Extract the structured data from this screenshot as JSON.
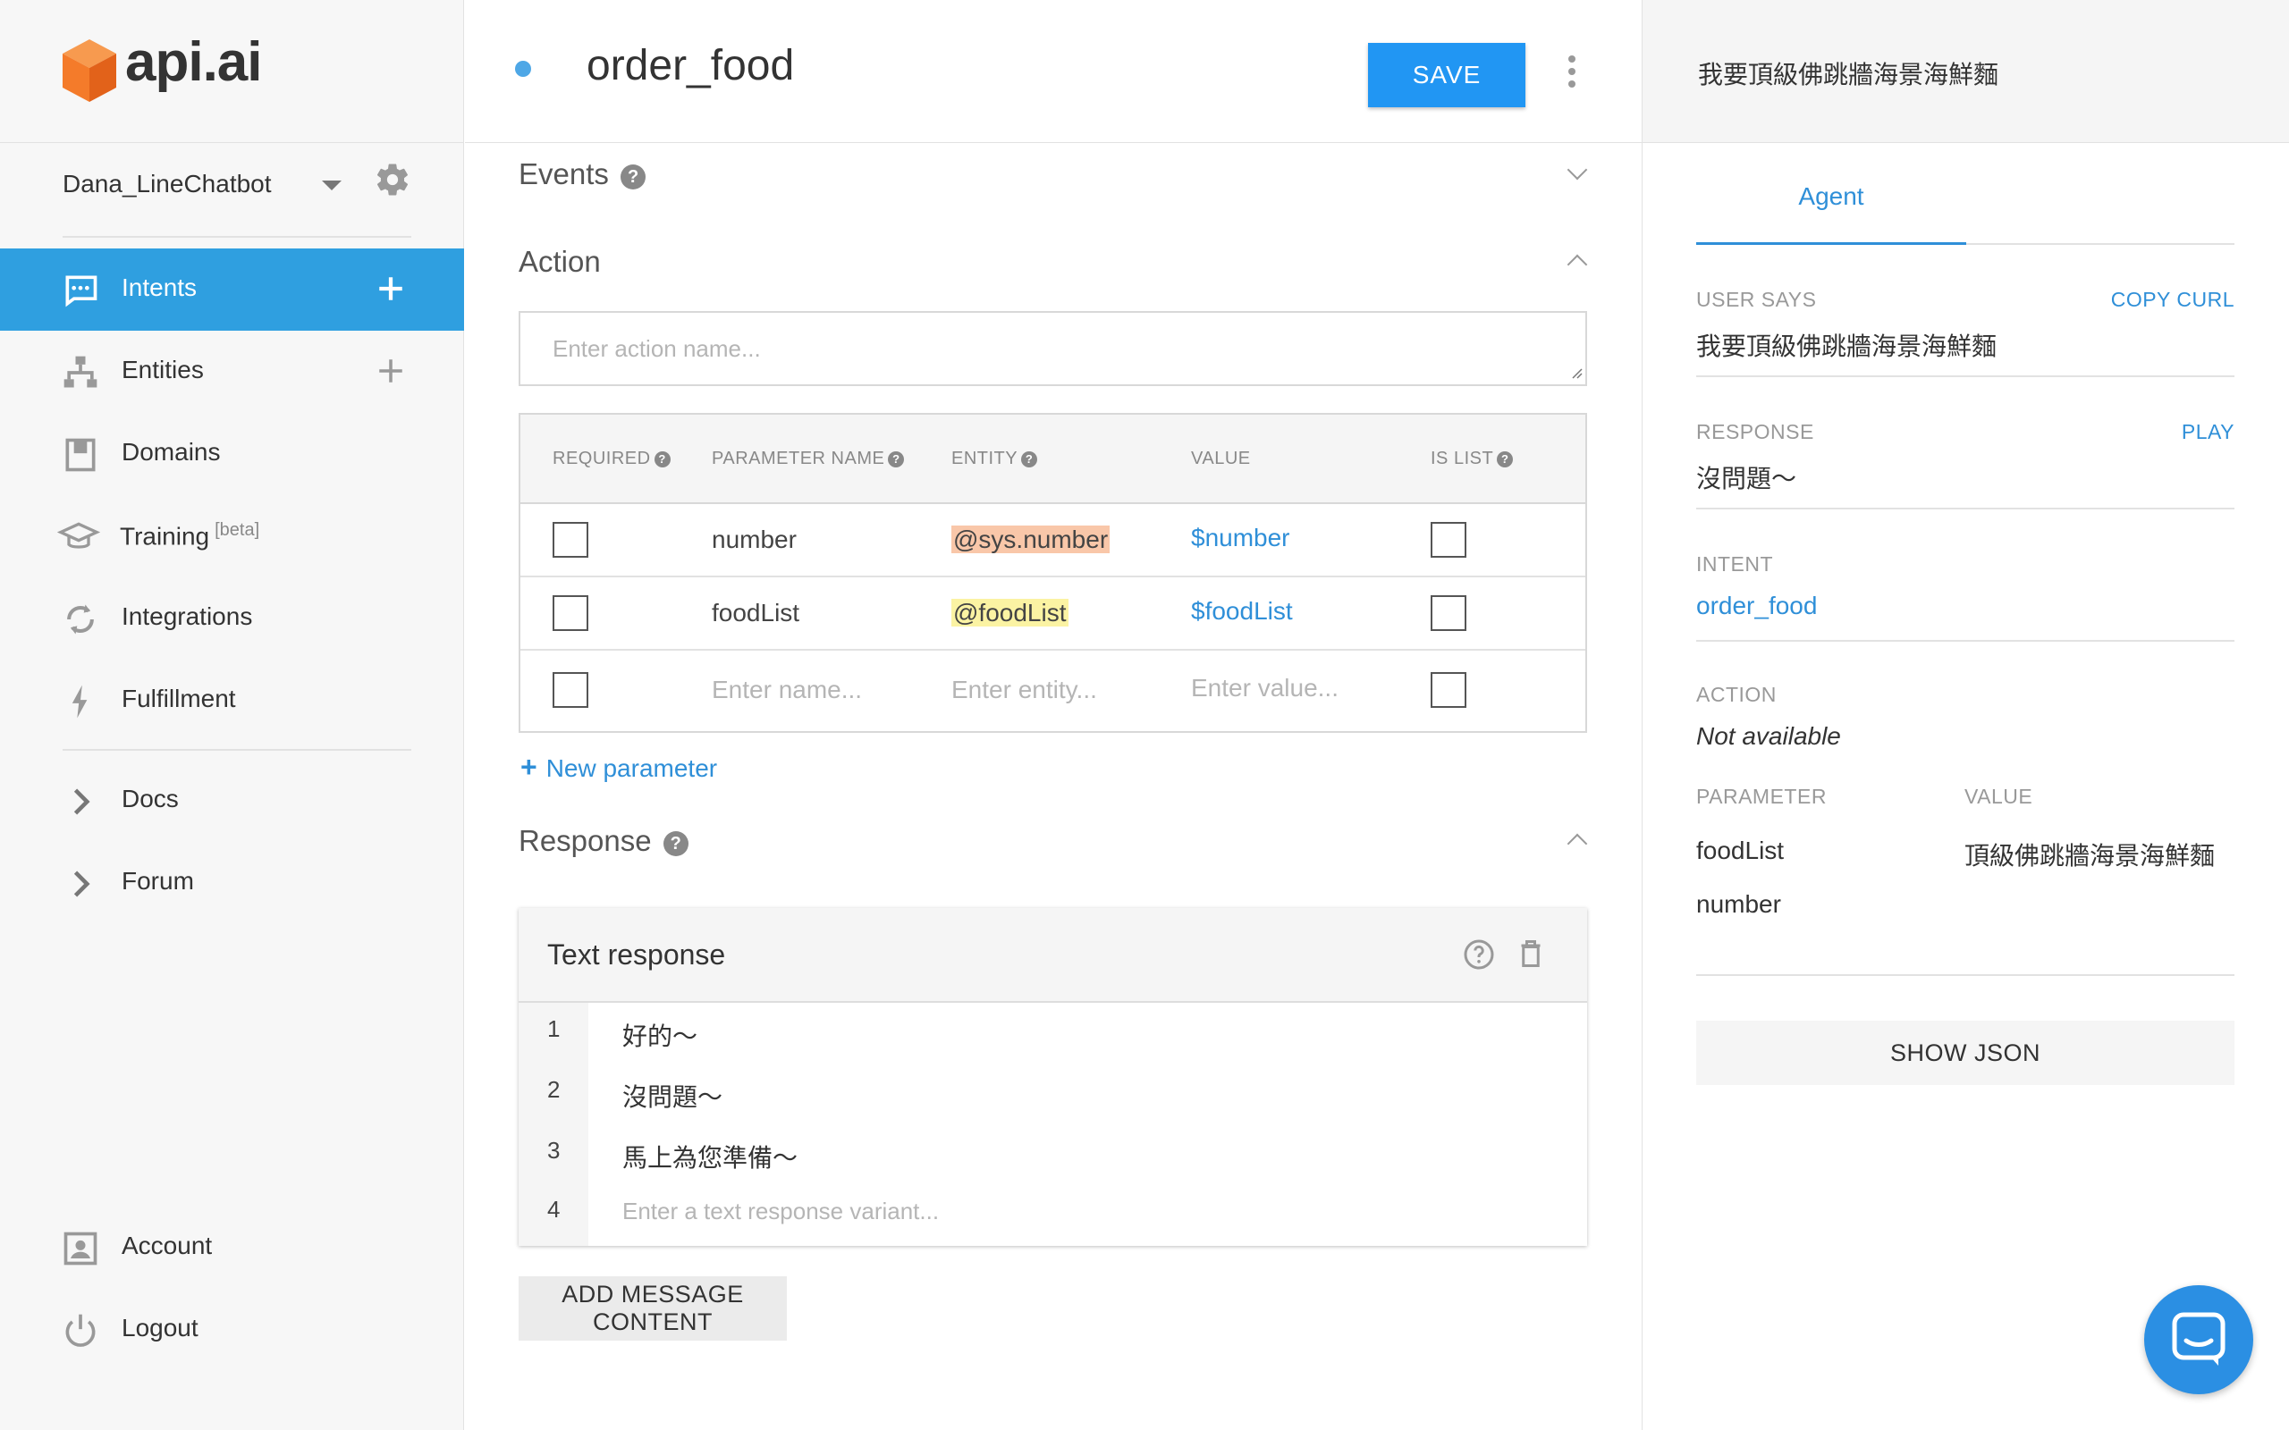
{
  "brand": {
    "name": "api.ai",
    "color": "#f47b2a"
  },
  "colors": {
    "accent": "#2196f3",
    "active_nav": "#2f9fe0",
    "link": "#2f8fd8"
  },
  "agent": {
    "name": "Dana_LineChatbot"
  },
  "nav": {
    "intents": "Intents",
    "entities": "Entities",
    "domains": "Domains",
    "training": "Training",
    "training_badge": "[beta]",
    "integrations": "Integrations",
    "fulfillment": "Fulfillment",
    "docs": "Docs",
    "forum": "Forum",
    "account": "Account",
    "logout": "Logout"
  },
  "intent": {
    "title": "order_food",
    "save_label": "SAVE"
  },
  "sections": {
    "events": "Events",
    "action": "Action",
    "response": "Response"
  },
  "action": {
    "placeholder": "Enter action name..."
  },
  "params_table": {
    "headers": {
      "required": "REQUIRED",
      "name": "PARAMETER NAME",
      "entity": "ENTITY",
      "value": "VALUE",
      "is_list": "IS LIST"
    },
    "rows": [
      {
        "name": "number",
        "entity": "@sys.number",
        "value": "$number"
      },
      {
        "name": "foodList",
        "entity": "@foodList",
        "value": "$foodList"
      }
    ],
    "new_row": {
      "name_ph": "Enter name...",
      "entity_ph": "Enter entity...",
      "value_ph": "Enter value..."
    },
    "new_param_label": "New parameter"
  },
  "response": {
    "card_title": "Text response",
    "lines": [
      {
        "num": "1",
        "text": "好的～"
      },
      {
        "num": "2",
        "text": "沒問題～"
      },
      {
        "num": "3",
        "text": "馬上為您準備～"
      }
    ],
    "new_line": {
      "num": "4",
      "placeholder": "Enter a text response variant..."
    },
    "add_content_label": "ADD MESSAGE CONTENT"
  },
  "console": {
    "query": "我要頂級佛跳牆海景海鮮麵",
    "tab": "Agent",
    "user_says_label": "USER SAYS",
    "copy_curl": "COPY CURL",
    "user_says": "我要頂級佛跳牆海景海鮮麵",
    "response_label": "RESPONSE",
    "play": "PLAY",
    "response": "沒問題～",
    "intent_label": "INTENT",
    "intent": "order_food",
    "action_label": "ACTION",
    "action": "Not available",
    "param_label": "PARAMETER",
    "value_label": "VALUE",
    "params": [
      {
        "name": "foodList",
        "value": "頂級佛跳牆海景海鮮麵"
      },
      {
        "name": "number",
        "value": ""
      }
    ],
    "show_json": "SHOW JSON"
  }
}
